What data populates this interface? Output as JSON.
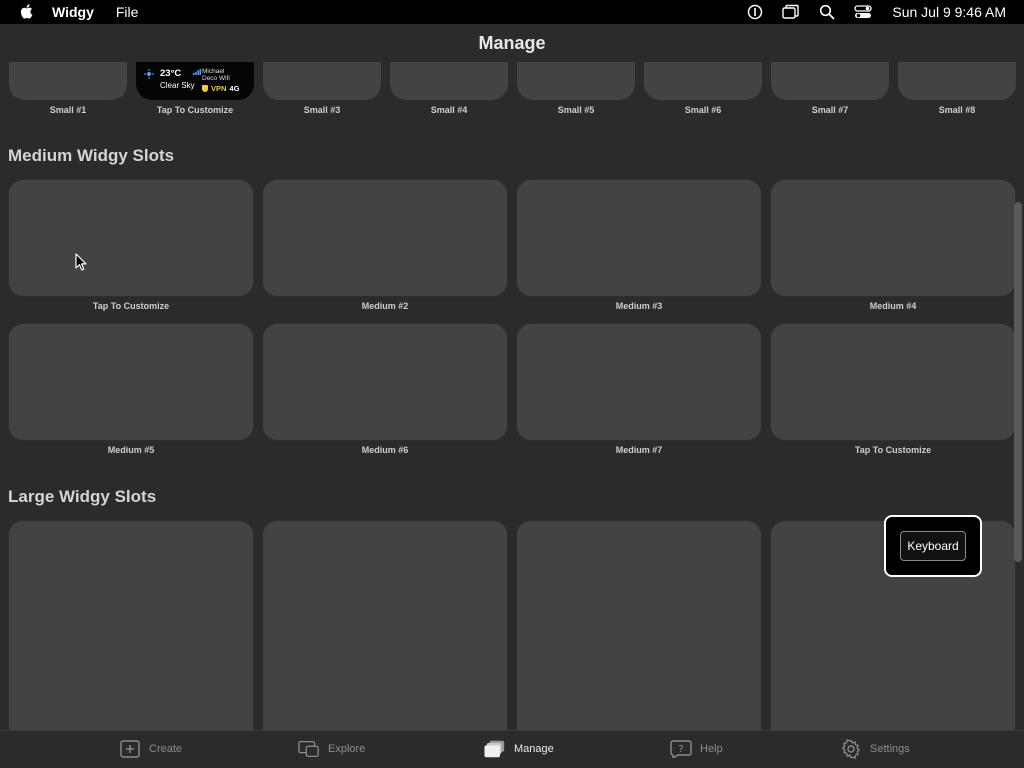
{
  "menubar": {
    "app_name": "Widgy",
    "menus": [
      "File"
    ],
    "clock": "Sun Jul 9  9:46 AM",
    "icons": [
      "apple-icon",
      "info-icon",
      "windows-icon",
      "search-icon",
      "control-center-icon"
    ]
  },
  "window": {
    "title": "Manage"
  },
  "small": {
    "labels": [
      "Small #1",
      "Tap To Customize",
      "Small #3",
      "Small #4",
      "Small #5",
      "Small #6",
      "Small #7",
      "Small #8"
    ],
    "widget": {
      "temp": "23°C",
      "condition": "Clear Sky",
      "wifi_line1": "Michael",
      "wifi_line2": "Deco Wifi",
      "vpn": "VPN",
      "network": "4G"
    }
  },
  "medium": {
    "title": "Medium Widgy Slots",
    "labels": [
      "Tap To Customize",
      "Medium #2",
      "Medium #3",
      "Medium #4",
      "Medium #5",
      "Medium #6",
      "Medium #7",
      "Tap To Customize"
    ]
  },
  "large": {
    "title": "Large Widgy Slots"
  },
  "popup": {
    "button": "Keyboard"
  },
  "tabs": [
    {
      "label": "Create",
      "icon": "plus-square-icon"
    },
    {
      "label": "Explore",
      "icon": "explore-windows-icon"
    },
    {
      "label": "Manage",
      "icon": "stack-cards-icon",
      "active": true
    },
    {
      "label": "Help",
      "icon": "question-icon"
    },
    {
      "label": "Settings",
      "icon": "gear-icon"
    }
  ],
  "colors": {
    "background": "#2b2b2b",
    "slot": "#434343",
    "menubar": "#000000",
    "vpn": "#f2c94c"
  }
}
